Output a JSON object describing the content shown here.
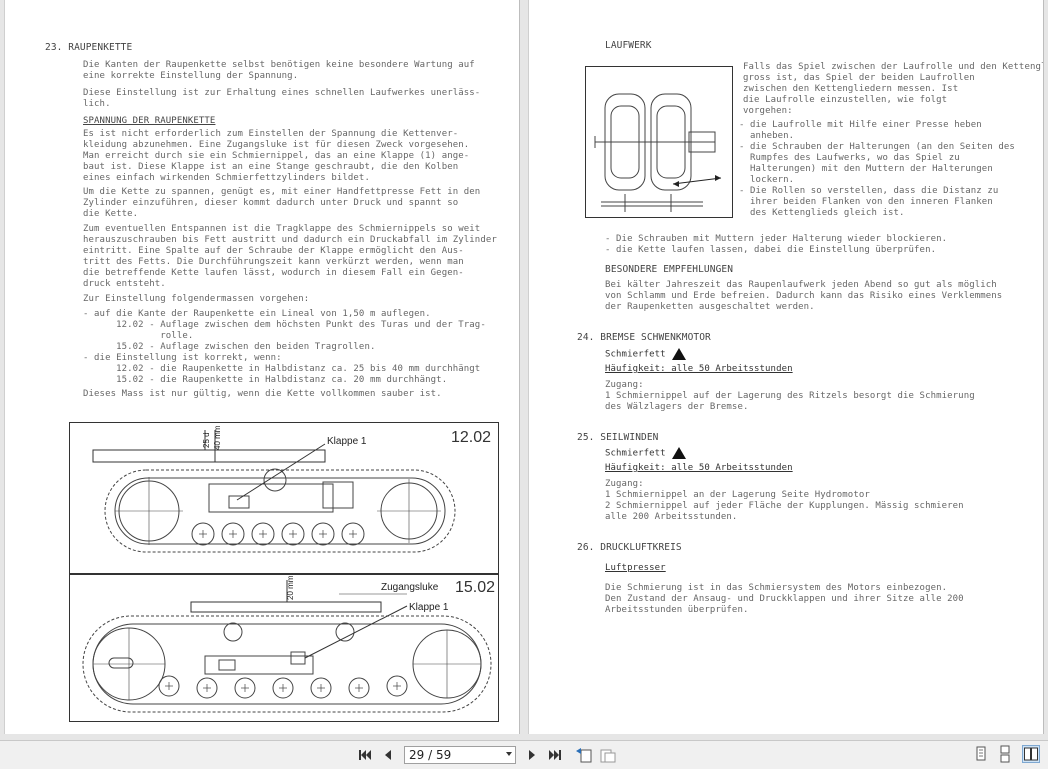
{
  "left_page": {
    "heading": "23. RAUPENKETTE",
    "p1": [
      "Die Kanten der Raupenkette selbst benötigen keine besondere Wartung auf",
      "eine korrekte Einstellung der Spannung."
    ],
    "p2": [
      "Diese Einstellung ist zur Erhaltung eines schnellen Laufwerkes unerläss-",
      "lich."
    ],
    "sub1": "SPANNUNG DER RAUPENKETTE",
    "p3": [
      "Es ist nicht erforderlich zum Einstellen der Spannung die Kettenver-",
      "kleidung abzunehmen. Eine Zugangsluke ist für diesen Zweck vorgesehen.",
      "Man erreicht durch sie ein Schmiernippel, das an eine Klappe (1) ange-",
      "baut ist. Diese Klappe ist an eine Stange geschraubt, die den Kolben",
      "eines einfach wirkenden Schmierfettzylinders bildet."
    ],
    "p4": [
      "Um die Kette zu spannen, genügt es, mit einer Handfettpresse Fett in den",
      "Zylinder einzuführen, dieser kommt dadurch unter Druck und spannt so",
      "die Kette."
    ],
    "p5": [
      "Zum eventuellen Entspannen ist die Tragklappe des Schmiernippels so weit",
      "herauszuschrauben bis Fett austritt und dadurch ein Druckabfall im Zylinder",
      "eintritt. Eine Spalte auf der Schraube der Klappe ermöglicht den Aus-",
      "tritt des Fetts. Die Durchführungszeit kann verkürzt werden, wenn man",
      "die betreffende Kette laufen lässt, wodurch in diesem Fall ein Gegen-",
      "druck entsteht."
    ],
    "p6": "Zur Einstellung folgendermassen vorgehen:",
    "list": [
      "- auf die Kante der Raupenkette ein Lineal von 1,50 m auflegen.",
      "      12.02 - Auflage zwischen dem höchsten Punkt des Turas und der Trag-",
      "              rolle.",
      "      15.02 - Auflage zwischen den beiden Tragrollen.",
      "- die Einstellung ist korrekt, wenn:",
      "      12.02 - die Raupenkette in Halbdistanz ca. 25 bis 40 mm durchhängt",
      "      15.02 - die Raupenkette in Halbdistanz ca. 20 mm durchhängt."
    ],
    "p7": "Dieses Mass ist nur gültig, wenn die Kette vollkommen sauber ist.",
    "fig1": {
      "model": "12.02",
      "label_klappe": "Klappe 1",
      "dim_a": "25 d",
      "dim_b": "40 mm"
    },
    "fig2": {
      "model": "15.02",
      "label_luke": "Zugangsluke",
      "label_klappe": "Klappe 1",
      "dim_a": "20 mm"
    }
  },
  "right_page": {
    "heading": "LAUFWERK",
    "p1": [
      "Falls das Spiel zwischen der Laufrolle und den Kettengliedern zu",
      "gross ist, das Spiel der beiden Laufrollen",
      "zwischen den Kettengliedern messen. Ist",
      "die Laufrolle einzustellen, wie folgt",
      "vorgehen:"
    ],
    "list1": [
      "- die Laufrolle mit Hilfe einer Presse heben",
      "  anheben.",
      "- die Schrauben der Halterungen (an den Seiten des",
      "  Rumpfes des Laufwerks, wo das Spiel zu",
      "  Halterungen) mit den Muttern der Halterungen",
      "  lockern.",
      "- Die Rollen so verstellen, dass die Distanz zu",
      "  ihrer beiden Flanken von den inneren Flanken",
      "  des Kettenglieds gleich ist."
    ],
    "list2": [
      "- Die Schrauben mit Muttern jeder Halterung wieder blockieren.",
      "- die Kette laufen lassen, dabei die Einstellung überprüfen."
    ],
    "sub_besonders": "BESONDERE EMPFEHLUNGEN",
    "p2": [
      "Bei kälter Jahreszeit das Raupenlaufwerk jeden Abend so gut als möglich",
      "von Schlamm und Erde befreien. Dadurch kann das Risiko eines Verklemmens",
      "der Raupenketten ausgeschaltet werden."
    ],
    "s24": {
      "title": "24. BREMSE SCHWENKMOTOR",
      "grease": "Schmierfett",
      "freq": "Häufigkeit: alle 50 Arbeitsstunden",
      "access": "Zugang:",
      "lines": [
        "1 Schmiernippel auf der Lagerung des Ritzels besorgt die Schmierung",
        "des Wälzlagers der Bremse."
      ]
    },
    "s25": {
      "title": "25. SEILWINDEN",
      "grease": "Schmierfett",
      "freq": "Häufigkeit: alle 50 Arbeitsstunden",
      "access": "Zugang:",
      "lines": [
        "1 Schmiernippel an der Lagerung Seite Hydromotor",
        "2 Schmiernippel auf jeder Fläche der Kupplungen. Mässig schmieren",
        "alle 200 Arbeitsstunden."
      ]
    },
    "s26": {
      "title": "26. DRUCKLUFTKREIS",
      "sub": "Luftpresser",
      "lines": [
        "Die Schmierung ist in das Schmiersystem des Motors einbezogen.",
        "Den Zustand der Ansaug- und Druckklappen und ihrer Sitze alle 200",
        "Arbeitsstunden überprüfen."
      ]
    }
  },
  "toolbar": {
    "page_value": "29 / 59",
    "first_icon": "first-page-icon",
    "prev_icon": "previous-page-icon",
    "next_icon": "next-page-icon",
    "last_icon": "last-page-icon"
  }
}
